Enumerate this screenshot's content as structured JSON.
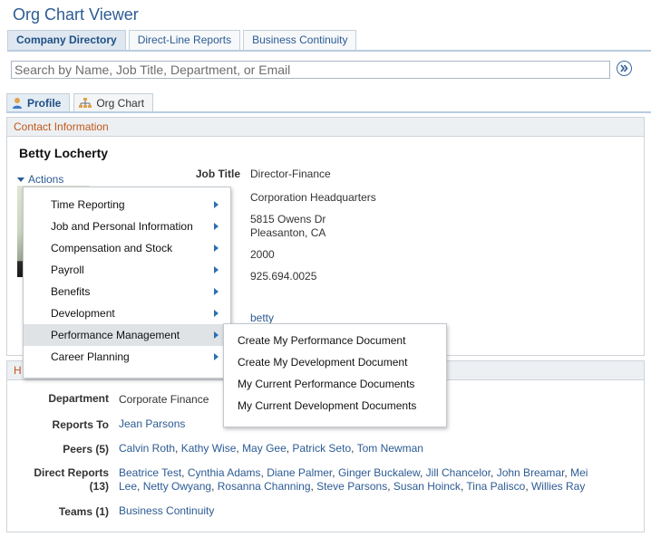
{
  "app": {
    "title": "Org Chart Viewer"
  },
  "top_tabs": [
    {
      "label": "Company Directory",
      "active": true
    },
    {
      "label": "Direct-Line Reports",
      "active": false
    },
    {
      "label": "Business Continuity",
      "active": false
    }
  ],
  "search": {
    "placeholder": "Search by Name, Job Title, Department, or Email",
    "value": "",
    "go_icon": "chevron-right-circle-icon"
  },
  "sub_tabs": [
    {
      "label": "Profile",
      "icon": "person-icon",
      "active": true
    },
    {
      "label": "Org Chart",
      "icon": "org-chart-icon",
      "active": false
    }
  ],
  "contact": {
    "header": "Contact Information",
    "name": "Betty Locherty",
    "actions_label": "Actions",
    "job_title_label": "Job Title",
    "job_title": "Director-Finance",
    "location": "Corporation Headquarters",
    "address_line1": "5815 Owens Dr",
    "address_line2": "Pleasanton, CA",
    "extension": "2000",
    "phone": "925.694.0025",
    "email": "betty"
  },
  "actions_menu": {
    "items": [
      "Time Reporting",
      "Job and Personal Information",
      "Compensation and Stock",
      "Payroll",
      "Benefits",
      "Development",
      "Performance Management",
      "Career Planning"
    ],
    "highlighted": "Performance Management"
  },
  "submenu": {
    "items": [
      "Create My Performance Document",
      "Create My Development Document",
      "My Current Performance Documents",
      "My Current Development Documents"
    ]
  },
  "hierarchy": {
    "header_initial": "H",
    "department_label": "Department",
    "department": "Corporate Finance",
    "reports_to_label": "Reports To",
    "reports_to": "Jean Parsons",
    "peers_label": "Peers (5)",
    "peers": [
      "Calvin Roth",
      "Kathy Wise",
      "May Gee",
      "Patrick Seto",
      "Tom Newman"
    ],
    "direct_reports_label_line1": "Direct Reports",
    "direct_reports_label_line2": "(13)",
    "direct_reports_line1": [
      "Beatrice Test",
      "Cynthia Adams",
      "Diane Palmer",
      "Ginger Buckalew",
      "Jill Chancelor",
      "John Breamar",
      "Mei"
    ],
    "direct_reports_line2": [
      "Lee",
      "Netty Owyang",
      "Rosanna Channing",
      "Steve Parsons",
      "Susan Hoinck",
      "Tina Palisco",
      "Willies Ray"
    ],
    "teams_label": "Teams (1)",
    "teams": "Business Continuity"
  },
  "colors": {
    "link": "#2c5b93",
    "section_header": "#c2571b",
    "title": "#2c5b93"
  }
}
